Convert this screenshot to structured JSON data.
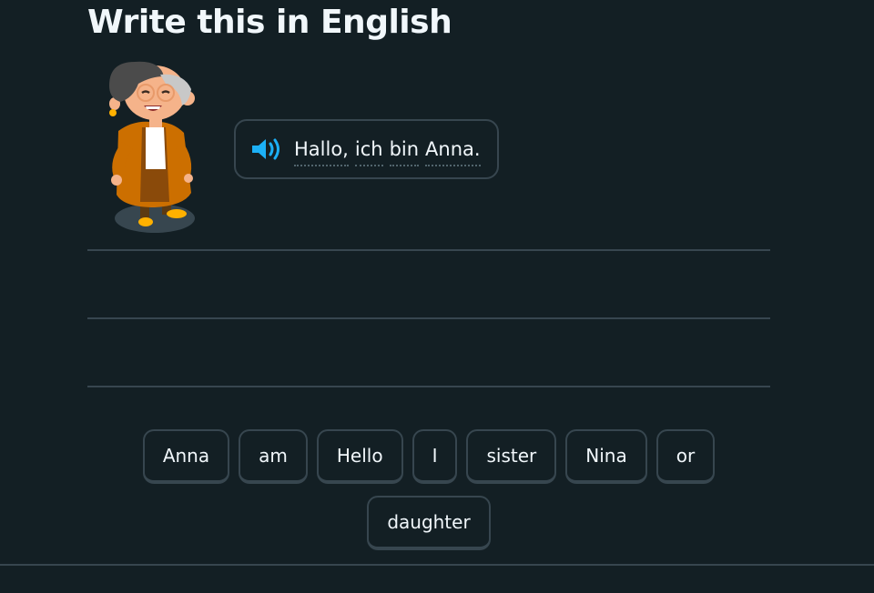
{
  "header": {
    "title": "Write this in English"
  },
  "prompt": {
    "speaker_icon": "speaker-icon",
    "words": [
      "Hallo,",
      "ich",
      "bin",
      "Anna."
    ]
  },
  "word_bank": {
    "tiles": [
      "Anna",
      "am",
      "Hello",
      "I",
      "sister",
      "Nina",
      "or",
      "daughter"
    ]
  },
  "colors": {
    "background": "#131f24",
    "border": "#37464f",
    "text": "#f1f7fb",
    "speaker": "#1cb0f6",
    "character_jacket": "#cc6f00"
  }
}
